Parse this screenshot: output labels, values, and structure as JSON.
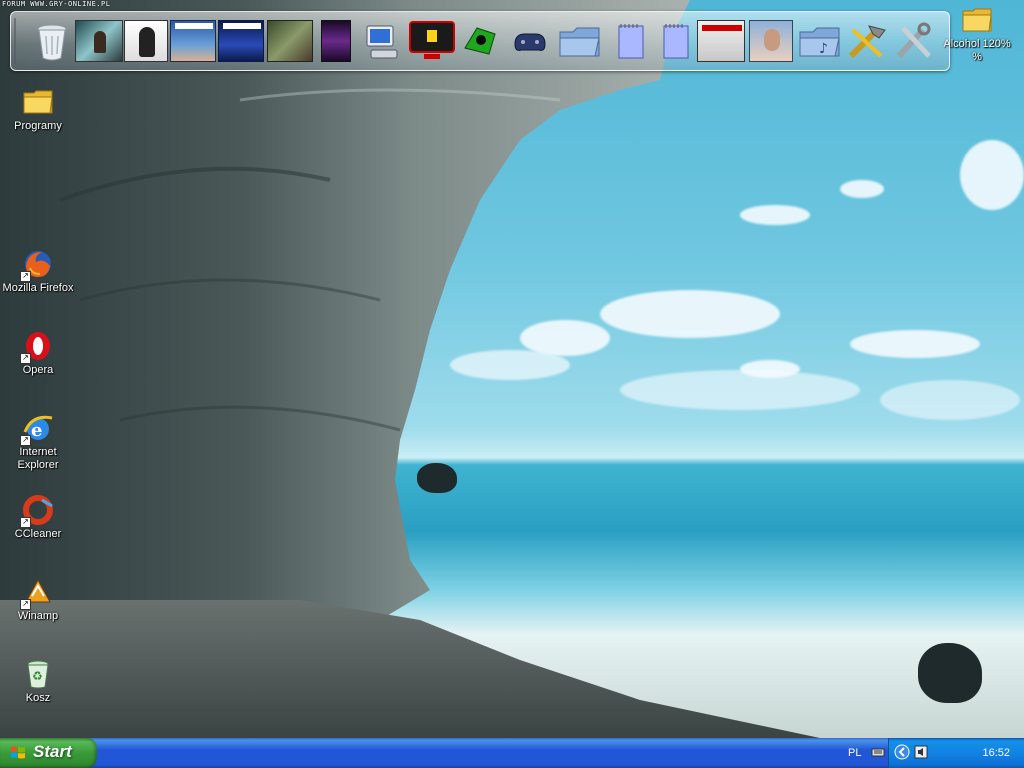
{
  "brand": {
    "text": "FORUM WWW.GRY-ONLINE.PL"
  },
  "dock": {
    "items": [
      {
        "icon": "recycle-bin-icon"
      },
      {
        "icon": "photo-thumbnail-1-icon"
      },
      {
        "icon": "photo-thumbnail-2-icon"
      },
      {
        "icon": "album-cover-bass-hunter-1-icon"
      },
      {
        "icon": "album-cover-bass-hunter-2-icon"
      },
      {
        "icon": "game-thumbnail-icon"
      },
      {
        "icon": "media-thumbnail-icon"
      },
      {
        "icon": "my-computer-icon"
      },
      {
        "icon": "ferrari-monitor-icon"
      },
      {
        "icon": "green-gadget-icon"
      },
      {
        "icon": "gamepad-icon"
      },
      {
        "icon": "folder-icon"
      },
      {
        "icon": "notepad-icon"
      },
      {
        "icon": "notepad-icon"
      },
      {
        "icon": "album-cover-photo-icon"
      },
      {
        "icon": "portrait-photo-icon"
      },
      {
        "icon": "music-folder-icon"
      },
      {
        "icon": "tools-icon"
      },
      {
        "icon": "system-tools-icon"
      }
    ]
  },
  "desktop": {
    "icons": [
      {
        "label": "Alcohol 120% %",
        "icon": "folder-icon"
      },
      {
        "label": "Programy",
        "icon": "folder-icon"
      },
      {
        "label": "Mozilla Firefox",
        "icon": "firefox-icon"
      },
      {
        "label": "Opera",
        "icon": "opera-icon"
      },
      {
        "label": "Internet Explorer",
        "icon": "internet-explorer-icon"
      },
      {
        "label": "CCleaner",
        "icon": "ccleaner-icon"
      },
      {
        "label": "Winamp",
        "icon": "winamp-icon"
      },
      {
        "label": "Kosz",
        "icon": "recycle-bin-icon"
      }
    ]
  },
  "taskbar": {
    "start_label": "Start",
    "language": "PL",
    "clock": "16:52"
  },
  "colors": {
    "taskbar_blue": "#2157d7",
    "start_green": "#3a9a3a",
    "tray_blue": "#1083e3"
  }
}
